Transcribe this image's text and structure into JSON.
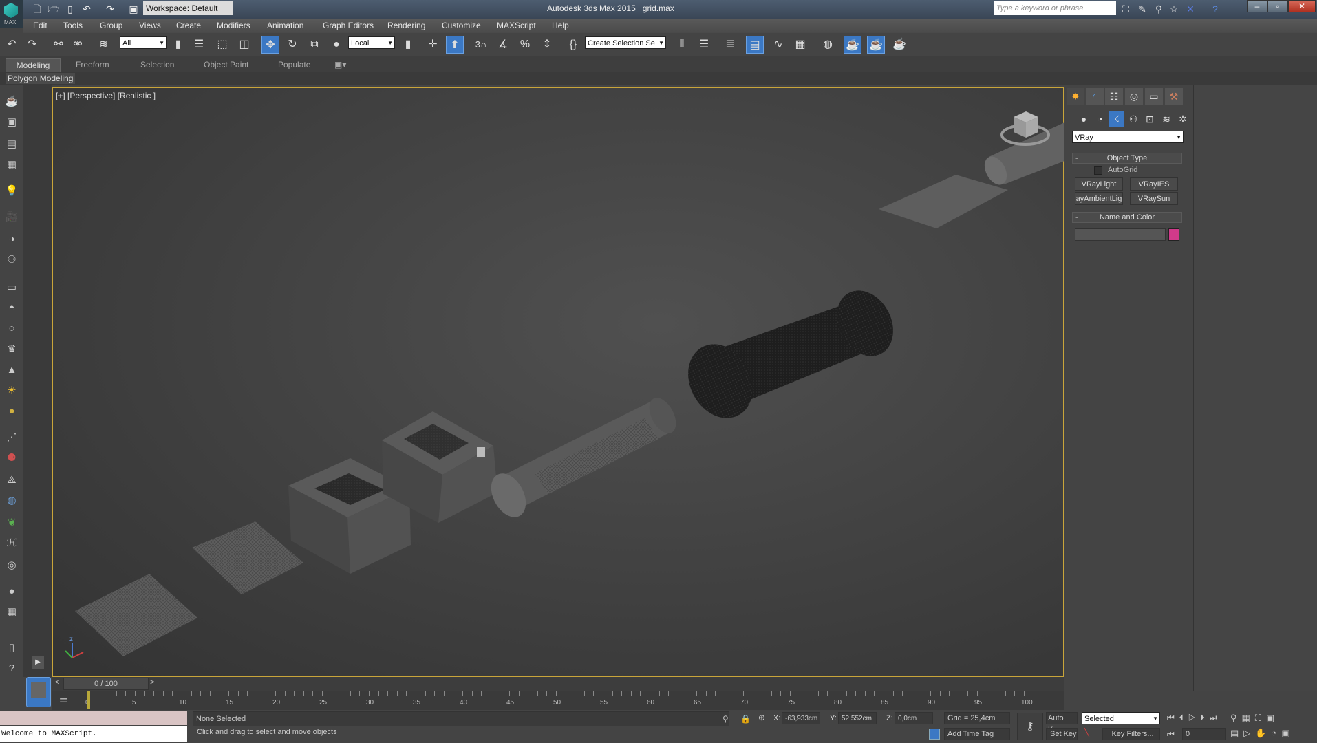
{
  "title": {
    "app": "Autodesk 3ds Max  2015",
    "file": "grid.max",
    "logo_text": "MAX",
    "workspace": "Workspace: Default",
    "search_placeholder": "Type a keyword or phrase"
  },
  "menu": [
    "Edit",
    "Tools",
    "Group",
    "Views",
    "Create",
    "Modifiers",
    "Animation",
    "Graph Editors",
    "Rendering",
    "Customize",
    "MAXScript",
    "Help"
  ],
  "toolbar": {
    "filter": "All",
    "coord": "Local",
    "named_sel": "Create Selection Se",
    "snap_label": "3"
  },
  "ribbon": {
    "tabs": [
      "Modeling",
      "Freeform",
      "Selection",
      "Object Paint",
      "Populate"
    ],
    "active": "Modeling",
    "panel": "Polygon Modeling"
  },
  "viewport": {
    "label": "[+] [Perspective] [Realistic ]",
    "axis": {
      "z": "z",
      "x": "x",
      "y": "y"
    }
  },
  "command_panel": {
    "renderer": "VRay",
    "object_type": "Object Type",
    "autogrid": "AutoGrid",
    "autogrid_checked": false,
    "buttons": [
      "VRayLight",
      "VRayIES",
      "ayAmbientLig",
      "VRaySun"
    ],
    "name_and_color": "Name and Color",
    "name_value": "",
    "color": "#d03a8a",
    "collapse": "-"
  },
  "timeline": {
    "frame": "0 / 100",
    "prev": "<",
    "next": ">",
    "ticks": [
      "0",
      "5",
      "10",
      "15",
      "20",
      "25",
      "30",
      "35",
      "40",
      "45",
      "50",
      "55",
      "60",
      "65",
      "70",
      "75",
      "80",
      "85",
      "90",
      "95",
      "100"
    ],
    "position": 0
  },
  "status": {
    "maxscript": "Welcome to MAXScript.",
    "selection": "None Selected",
    "prompt": "Click and drag to select and move objects",
    "x_label": "X:",
    "x": "-63,933cm",
    "y_label": "Y:",
    "y": "52,552cm",
    "z_label": "Z:",
    "z": "0,0cm",
    "grid": "Grid = 25,4cm",
    "add_time_tag": "Add Time Tag",
    "auto_key": "Auto Key",
    "set_key": "Set Key",
    "key_mode": "Selected",
    "key_filters": "Key Filters...",
    "current_frame": "0"
  },
  "colors": {
    "viewport_border": "#c9a53a",
    "active_blue": "#3b78c4"
  }
}
